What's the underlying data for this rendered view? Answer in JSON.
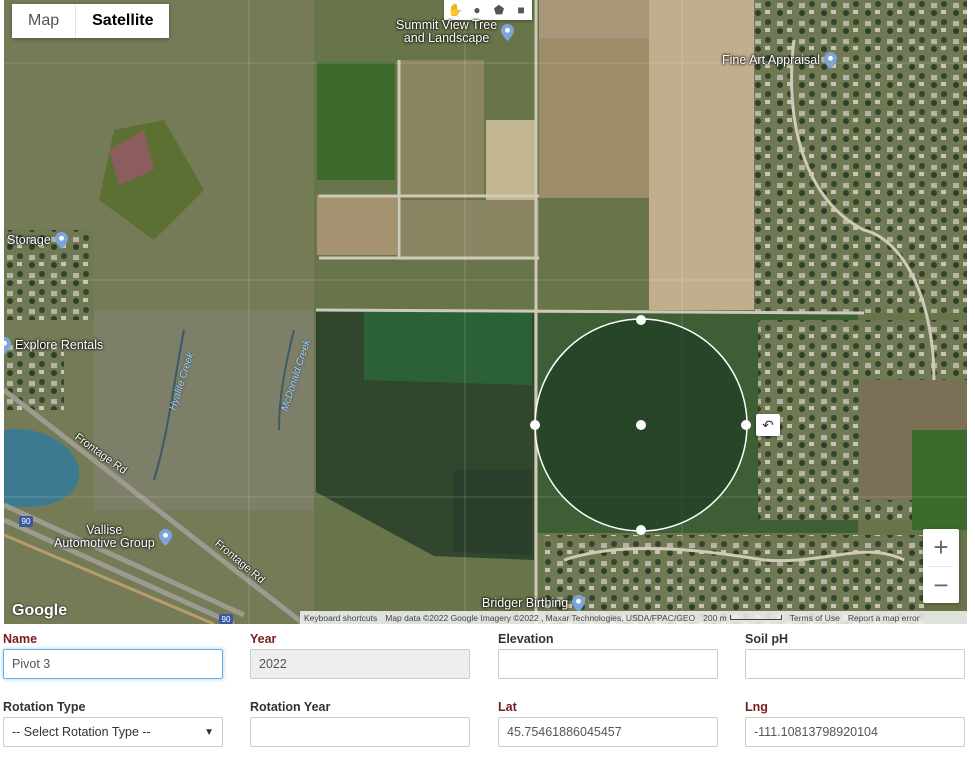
{
  "map": {
    "type_buttons": [
      {
        "label": "Map",
        "active": false
      },
      {
        "label": "Satellite",
        "active": true
      }
    ],
    "places": [
      {
        "name": "Summit View Tree\nand Landscape"
      },
      {
        "name": "Fine Art Appraisal"
      },
      {
        "name": "Storage"
      },
      {
        "name": "Explore Rentals"
      },
      {
        "name": "Vallise\nAutomotive Group"
      },
      {
        "name": "Bridger Birthing"
      }
    ],
    "roads": [
      "Frontage Rd",
      "Frontage Rd"
    ],
    "creeks": [
      "Hyalite Creek",
      "McDonald Creek"
    ],
    "highway_shields": [
      "90",
      "90"
    ],
    "zoom_in": "+",
    "zoom_out": "−",
    "logo": "Google",
    "attribution": {
      "shortcuts": "Keyboard shortcuts",
      "data": "Map data ©2022 Google Imagery ©2022 , Maxar Technologies, USDA/FPAC/GEO",
      "scale": "200 m",
      "terms": "Terms of Use",
      "report": "Report a map error"
    }
  },
  "form": {
    "name": {
      "label": "Name",
      "value": "Pivot 3"
    },
    "year": {
      "label": "Year",
      "value": "2022"
    },
    "elevation": {
      "label": "Elevation",
      "value": ""
    },
    "soil_ph": {
      "label": "Soil pH",
      "value": ""
    },
    "rotation_type": {
      "label": "Rotation Type",
      "value": "-- Select Rotation Type --"
    },
    "rotation_year": {
      "label": "Rotation Year",
      "value": ""
    },
    "lat": {
      "label": "Lat",
      "value": "45.75461886045457"
    },
    "lng": {
      "label": "Lng",
      "value": "-111.10813798920104"
    }
  }
}
